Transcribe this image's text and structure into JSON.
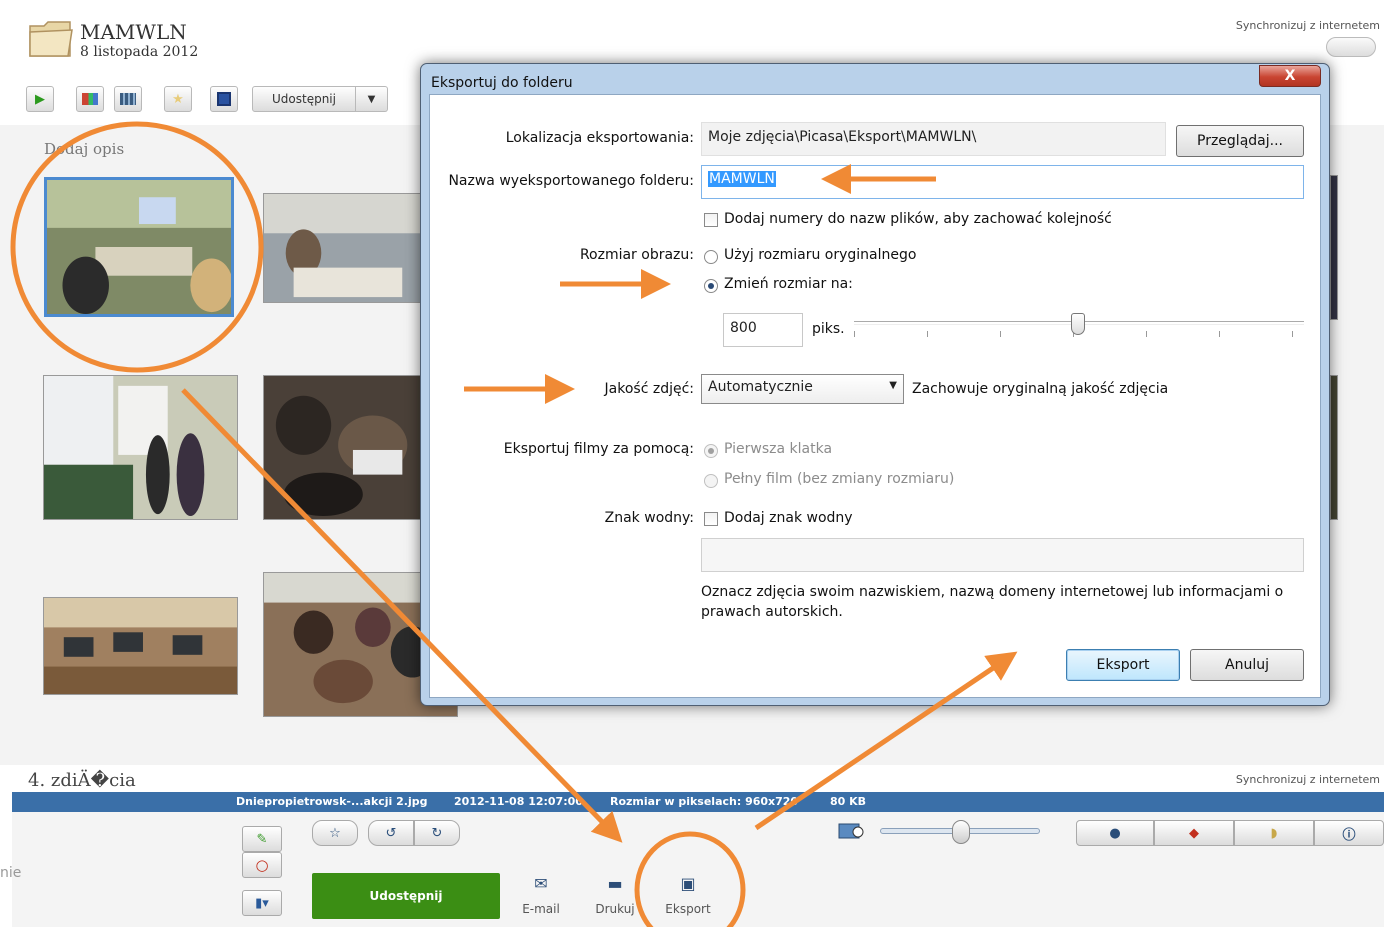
{
  "album": {
    "title": "MAMWLN",
    "date": "8 listopada 2012",
    "sync_label": "Synchronizuj z internetem",
    "add_description": "Dodaj opis",
    "share_label": "Udostępnij"
  },
  "second_album": {
    "title": "4. zdiÄ�cia",
    "sync_label": "Synchronizuj z internetem"
  },
  "status_bar": {
    "filename": "Dniepropietrowsk-...akcji 2.jpg",
    "datetime": "2012-11-08 12:07:00",
    "pixel_size": "Rozmiar w pikselach: 960x720",
    "file_size": "80 KB"
  },
  "bottom_panel": {
    "side_word": "nie",
    "share_label": "Udostępnij",
    "email_label": "E-mail",
    "print_label": "Drukuj",
    "export_label": "Eksport"
  },
  "dialog": {
    "title": "Eksportuj do folderu",
    "close_label": "X",
    "location_label": "Lokalizacja eksportowania:",
    "location_value": "Moje zdjęcia\\Picasa\\Eksport\\MAMWLN\\",
    "browse_label": "Przeglądaj...",
    "folder_name_label": "Nazwa wyeksportowanego folderu:",
    "folder_name_value": "MAMWLN",
    "add_numbers_label": "Dodaj numery do nazw plików, aby zachować kolejność",
    "image_size_label": "Rozmiar obrazu:",
    "original_size_label": "Użyj rozmiaru oryginalnego",
    "resize_label": "Zmień rozmiar na:",
    "resize_value": "800",
    "resize_unit": "piks.",
    "quality_label": "Jakość zdjęć:",
    "quality_value": "Automatycznie",
    "quality_note": "Zachowuje oryginalną jakość zdjęcia",
    "export_movies_label": "Eksportuj filmy za pomocą:",
    "first_frame_label": "Pierwsza klatka",
    "full_movie_label": "Pełny film (bez zmiany rozmiaru)",
    "watermark_label": "Znak wodny:",
    "add_watermark_label": "Dodaj znak wodny",
    "watermark_text": "",
    "watermark_hint": "Oznacz zdjęcia swoim nazwiskiem, nazwą domeny internetowej lub informacjami o prawach autorskich.",
    "export_button": "Eksport",
    "cancel_button": "Anuluj"
  },
  "state": {
    "resize_selected": true,
    "add_numbers_checked": false,
    "add_watermark_checked": false,
    "resize_slider_fraction": 0.5
  },
  "colors": {
    "annotation": "#f08a35",
    "share_green": "#3b8e14",
    "status_bar": "#3a6fa8",
    "dialog_frame": "#b9d1ea"
  }
}
